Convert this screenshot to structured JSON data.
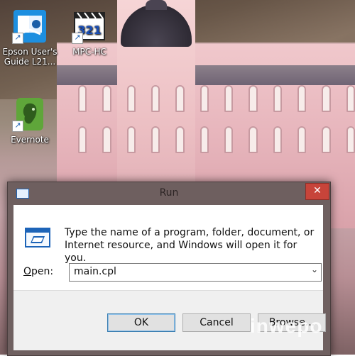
{
  "desktop": {
    "icons": [
      {
        "name": "Epson User's Guide L21...",
        "line1": "Epson User's",
        "line2": "Guide L21..."
      },
      {
        "name": "MPC-HC",
        "line1": "MPC-HC",
        "line2": ""
      },
      {
        "name": "Evernote",
        "line1": "Evernote",
        "line2": ""
      }
    ],
    "mpc_badge": "321"
  },
  "run_dialog": {
    "title": "Run",
    "close_glyph": "✕",
    "prompt": "Type the name of a program, folder, document, or Internet resource, and Windows will open it for you.",
    "open_label_prefix": "O",
    "open_label_rest": "pen:",
    "open_value": "main.cpl",
    "buttons": {
      "ok": "OK",
      "cancel": "Cancel",
      "browse": "Browse..."
    },
    "dropdown_glyph": "⌄"
  },
  "watermark": "inwepo",
  "colors": {
    "accent_blue": "#1d64b8",
    "close_red": "#c7443a",
    "dialog_frame": "#6e5f5f",
    "evernote_green": "#5fa63a"
  }
}
